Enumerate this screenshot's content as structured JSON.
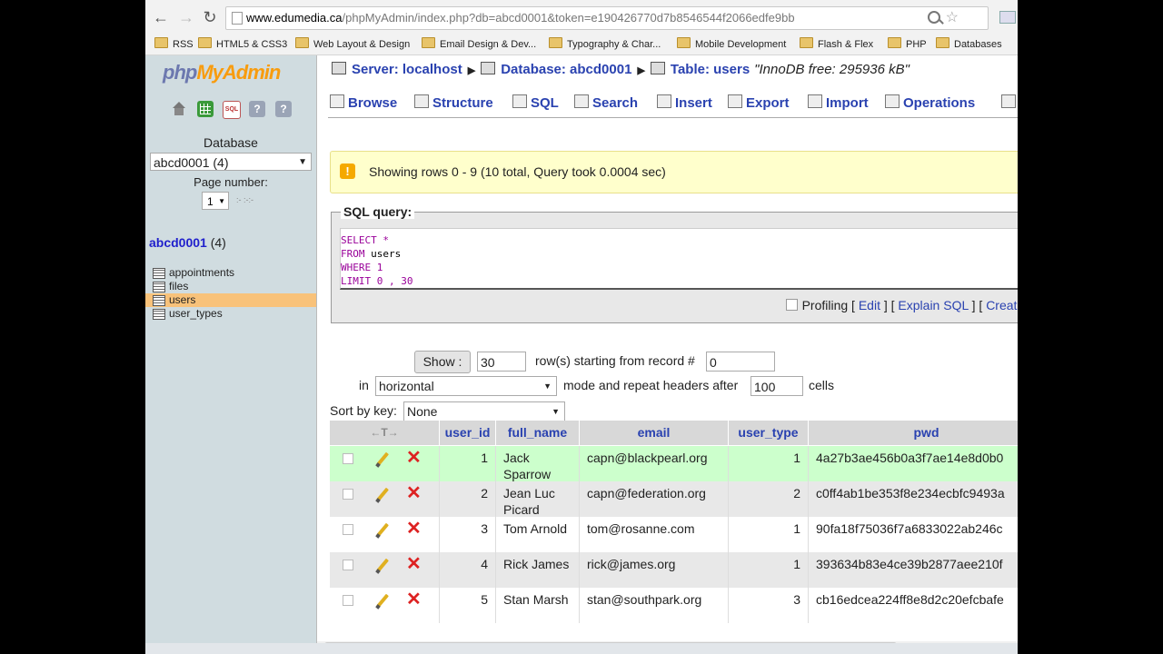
{
  "browser": {
    "url_host": "www.edumedia.ca",
    "url_rest": "/phpMyAdmin/index.php?db=abcd0001&token=e190426770d7b8546544f2066edfe9bb",
    "bookmarks": [
      "RSS",
      "HTML5 & CSS3",
      "Web Layout & Design",
      "Email Design & Dev...",
      "Typography & Char...",
      "Mobile Development",
      "Flash & Flex",
      "PHP",
      "Databases"
    ]
  },
  "sidebar": {
    "logo_php": "php",
    "logo_admin": "MyAdmin",
    "database_label": "Database",
    "database_selected": "abcd0001 (4)",
    "page_number_label": "Page number:",
    "page_number_value": "1",
    "page_arrows": ":- :-:-",
    "db_link": "abcd0001",
    "db_count": "(4)",
    "tables": [
      {
        "label": "appointments",
        "active": false
      },
      {
        "label": "files",
        "active": false
      },
      {
        "label": "users",
        "active": true
      },
      {
        "label": "user_types",
        "active": false
      }
    ]
  },
  "breadcrumb": {
    "server": "Server: localhost",
    "database": "Database: abcd0001",
    "table": "Table: users",
    "comment": "\"InnoDB free: 295936 kB\""
  },
  "tabs": [
    "Browse",
    "Structure",
    "SQL",
    "Search",
    "Insert",
    "Export",
    "Import",
    "Operations"
  ],
  "notice": "Showing rows 0 - 9 (10 total, Query took 0.0004 sec)",
  "sql": {
    "legend": "SQL query:",
    "line1_kw": "SELECT",
    "line1_rest": " *",
    "line2_kw": "FROM",
    "line2_rest": " users",
    "line3_kw": "WHERE",
    "line3_rest": " 1",
    "line4_kw": "LIMIT",
    "line4_rest": " 0 , 30",
    "profiling": "Profiling",
    "edit": "Edit",
    "explain": "Explain SQL",
    "create": "Create I"
  },
  "controls": {
    "show_button": "Show :",
    "rows_value": "30",
    "rows_label": "row(s) starting from record #",
    "start_value": "0",
    "in_label": "in",
    "mode_value": "horizontal",
    "mode_label": "mode and repeat headers after",
    "headers_value": "100",
    "cells_label": "cells",
    "sortby_label": "Sort by key:",
    "sortby_value": "None"
  },
  "grid": {
    "arrows": "←T→",
    "columns": [
      "user_id",
      "full_name",
      "email",
      "user_type",
      "pwd"
    ],
    "rows": [
      {
        "user_id": "1",
        "full_name": "Jack Sparrow",
        "email": "capn@blackpearl.org",
        "user_type": "1",
        "pwd": "4a27b3ae456b0a3f7ae14e8d0b0"
      },
      {
        "user_id": "2",
        "full_name": "Jean Luc Picard",
        "email": "capn@federation.org",
        "user_type": "2",
        "pwd": "c0ff4ab1be353f8e234ecbfc9493a"
      },
      {
        "user_id": "3",
        "full_name": "Tom Arnold",
        "email": "tom@rosanne.com",
        "user_type": "1",
        "pwd": "90fa18f75036f7a6833022ab246c"
      },
      {
        "user_id": "4",
        "full_name": "Rick James",
        "email": "rick@james.org",
        "user_type": "1",
        "pwd": "393634b83e4ce39b2877aee210f"
      },
      {
        "user_id": "5",
        "full_name": "Stan Marsh",
        "email": "stan@southpark.org",
        "user_type": "3",
        "pwd": "cb16edcea224ff8e8d2c20efcbafe"
      }
    ]
  },
  "colors": {
    "link": "#2a42b0",
    "sidebar_bg": "#d0dce0",
    "active_table": "#f8c27a",
    "selected_row": "#ccffcc",
    "notice_bg": "#ffffcc",
    "sql_keyword": "#990099"
  }
}
